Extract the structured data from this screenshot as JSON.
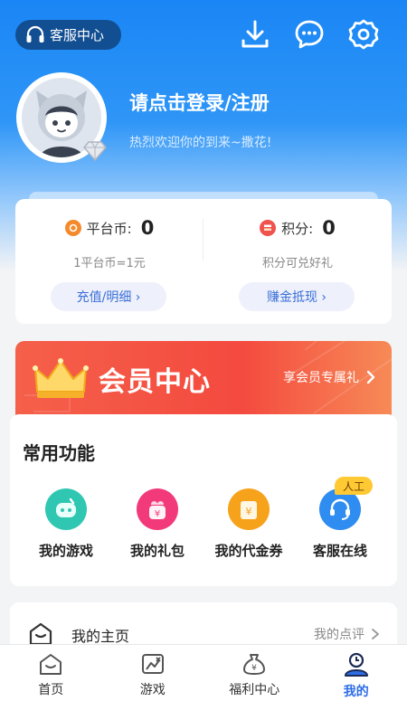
{
  "header": {
    "cs_label": "客服中心",
    "icons": [
      "headset-icon",
      "download-icon",
      "message-icon",
      "settings-icon"
    ]
  },
  "profile": {
    "title": "请点击登录/注册",
    "subtitle": "热烈欢迎你的到来~撒花!"
  },
  "wallet": {
    "platform": {
      "label": "平台币:",
      "value": "0",
      "note": "1平台币=1元",
      "button": "充值/明细 ›"
    },
    "points": {
      "label": "积分:",
      "value": "0",
      "note": "积分可兑好礼",
      "button": "赚金抵现 ›"
    }
  },
  "vip": {
    "title": "会员中心",
    "link": "享会员专属礼"
  },
  "functions": {
    "title": "常用功能",
    "items": [
      {
        "label": "我的游戏",
        "icon": "game-controller-icon",
        "color": "#2fc7b2"
      },
      {
        "label": "我的礼包",
        "icon": "gift-icon",
        "color": "#f2397a"
      },
      {
        "label": "我的代金券",
        "icon": "voucher-icon",
        "color": "#f7a21b"
      },
      {
        "label": "客服在线",
        "icon": "customer-service-icon",
        "color": "#2f8cf0"
      }
    ],
    "badge": "人工"
  },
  "homepage_row": {
    "label": "我的主页",
    "right": "我的点评"
  },
  "tabbar": {
    "tabs": [
      {
        "label": "首页",
        "icon": "home-icon"
      },
      {
        "label": "游戏",
        "icon": "game-icon"
      },
      {
        "label": "福利中心",
        "icon": "money-bag-icon"
      },
      {
        "label": "我的",
        "icon": "profile-icon",
        "active": true
      }
    ]
  },
  "colors": {
    "primary": "#1a86f5",
    "accent": "#2e6de6",
    "vip": "#f44a3f"
  }
}
